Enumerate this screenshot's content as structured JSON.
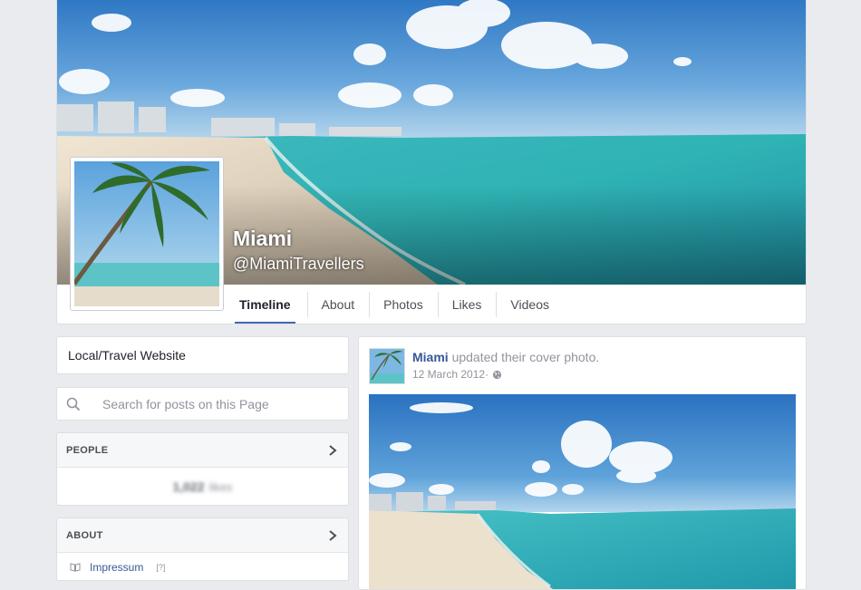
{
  "page": {
    "name": "Miami",
    "handle": "@MiamiTravellers"
  },
  "tabs": [
    {
      "label": "Timeline",
      "active": true
    },
    {
      "label": "About",
      "active": false
    },
    {
      "label": "Photos",
      "active": false
    },
    {
      "label": "Likes",
      "active": false
    },
    {
      "label": "Videos",
      "active": false
    }
  ],
  "sidebar": {
    "category": "Local/Travel Website",
    "search_placeholder": "Search for posts on this Page",
    "people": {
      "heading": "PEOPLE",
      "likes_count": "1,022",
      "likes_label": "likes"
    },
    "about": {
      "heading": "ABOUT",
      "impressum_label": "Impressum",
      "help_mark": "[?]"
    }
  },
  "post": {
    "author": "Miami",
    "action": " updated their cover photo.",
    "date": "12 March 2012",
    "separator": " · ",
    "privacy_icon": "globe-icon"
  },
  "icons": {
    "search": "search-icon",
    "chevron": "chevron-right-icon",
    "impressum": "book-icon"
  },
  "colors": {
    "link_blue": "#365899",
    "tab_underline": "#4267b2",
    "background": "#e9ebee"
  }
}
